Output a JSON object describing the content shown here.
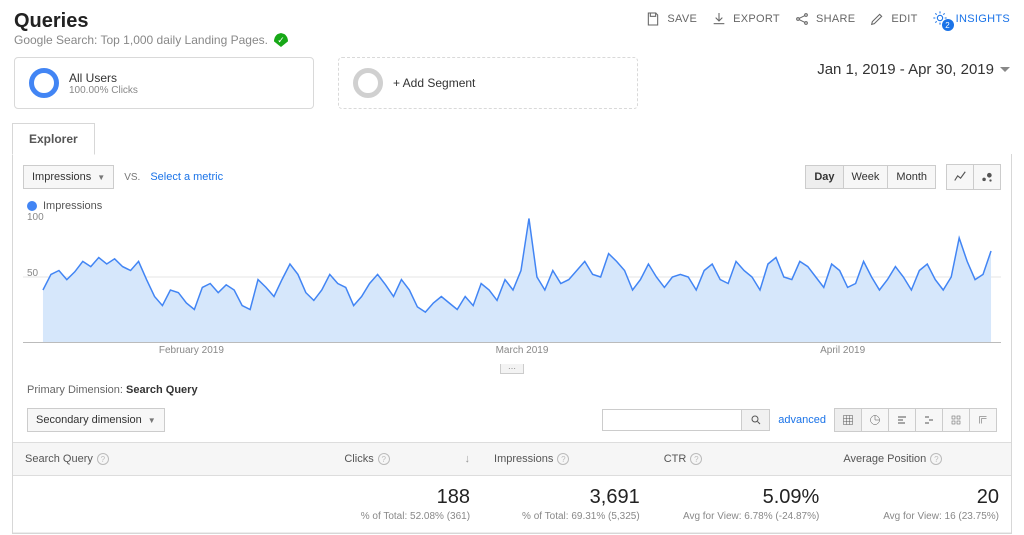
{
  "title": "Queries",
  "subtitle": "Google Search: Top 1,000 daily Landing Pages.",
  "actions": {
    "save": "SAVE",
    "export": "EXPORT",
    "share": "SHARE",
    "edit": "EDIT",
    "insights": "INSIGHTS",
    "insights_count": "2"
  },
  "segments": {
    "all_users": {
      "name": "All Users",
      "detail": "100.00% Clicks"
    },
    "add": {
      "label": "+ Add Segment"
    }
  },
  "date_range": "Jan 1, 2019 - Apr 30, 2019",
  "explorer": {
    "tab": "Explorer",
    "metric": "Impressions",
    "vs": "VS.",
    "select_metric": "Select a metric",
    "legend": "Impressions",
    "granularity": {
      "day": "Day",
      "week": "Week",
      "month": "Month"
    },
    "y_labels": {
      "top": "100",
      "mid": "50"
    },
    "x_labels": [
      "February 2019",
      "March 2019",
      "April 2019"
    ]
  },
  "primary_dimension": {
    "label": "Primary Dimension:",
    "value": "Search Query"
  },
  "secondary_dimension": "Secondary dimension",
  "search": {
    "placeholder": "",
    "advanced": "advanced"
  },
  "table": {
    "headers": {
      "query": "Search Query",
      "clicks": "Clicks",
      "impressions": "Impressions",
      "ctr": "CTR",
      "avg_pos": "Average Position"
    },
    "totals": {
      "clicks": {
        "value": "188",
        "sub": "% of Total: 52.08% (361)"
      },
      "impressions": {
        "value": "3,691",
        "sub": "% of Total: 69.31% (5,325)"
      },
      "ctr": {
        "value": "5.09%",
        "sub": "Avg for View: 6.78% (-24.87%)"
      },
      "avg_pos": {
        "value": "20",
        "sub": "Avg for View: 16 (23.75%)"
      }
    }
  },
  "chart_data": {
    "type": "line",
    "title": "Impressions",
    "ylabel": "Impressions",
    "ylim": [
      0,
      100
    ],
    "x": [
      "Jan 1",
      "Jan 2",
      "Jan 3",
      "Jan 4",
      "Jan 5",
      "Jan 6",
      "Jan 7",
      "Jan 8",
      "Jan 9",
      "Jan 10",
      "Jan 11",
      "Jan 12",
      "Jan 13",
      "Jan 14",
      "Jan 15",
      "Jan 16",
      "Jan 17",
      "Jan 18",
      "Jan 19",
      "Jan 20",
      "Jan 21",
      "Jan 22",
      "Jan 23",
      "Jan 24",
      "Jan 25",
      "Jan 26",
      "Jan 27",
      "Jan 28",
      "Jan 29",
      "Jan 30",
      "Jan 31",
      "Feb 1",
      "Feb 2",
      "Feb 3",
      "Feb 4",
      "Feb 5",
      "Feb 6",
      "Feb 7",
      "Feb 8",
      "Feb 9",
      "Feb 10",
      "Feb 11",
      "Feb 12",
      "Feb 13",
      "Feb 14",
      "Feb 15",
      "Feb 16",
      "Feb 17",
      "Feb 18",
      "Feb 19",
      "Feb 20",
      "Feb 21",
      "Feb 22",
      "Feb 23",
      "Feb 24",
      "Feb 25",
      "Feb 26",
      "Feb 27",
      "Feb 28",
      "Mar 1",
      "Mar 2",
      "Mar 3",
      "Mar 4",
      "Mar 5",
      "Mar 6",
      "Mar 7",
      "Mar 8",
      "Mar 9",
      "Mar 10",
      "Mar 11",
      "Mar 12",
      "Mar 13",
      "Mar 14",
      "Mar 15",
      "Mar 16",
      "Mar 17",
      "Mar 18",
      "Mar 19",
      "Mar 20",
      "Mar 21",
      "Mar 22",
      "Mar 23",
      "Mar 24",
      "Mar 25",
      "Mar 26",
      "Mar 27",
      "Mar 28",
      "Mar 29",
      "Mar 30",
      "Mar 31",
      "Apr 1",
      "Apr 2",
      "Apr 3",
      "Apr 4",
      "Apr 5",
      "Apr 6",
      "Apr 7",
      "Apr 8",
      "Apr 9",
      "Apr 10",
      "Apr 11",
      "Apr 12",
      "Apr 13",
      "Apr 14",
      "Apr 15",
      "Apr 16",
      "Apr 17",
      "Apr 18",
      "Apr 19",
      "Apr 20",
      "Apr 21",
      "Apr 22",
      "Apr 23",
      "Apr 24",
      "Apr 25",
      "Apr 26",
      "Apr 27",
      "Apr 28",
      "Apr 29",
      "Apr 30"
    ],
    "values": [
      40,
      52,
      55,
      48,
      54,
      62,
      58,
      65,
      60,
      64,
      58,
      55,
      62,
      48,
      35,
      28,
      40,
      38,
      30,
      25,
      42,
      45,
      38,
      44,
      40,
      28,
      25,
      48,
      42,
      35,
      48,
      60,
      52,
      38,
      32,
      40,
      52,
      45,
      42,
      28,
      35,
      45,
      52,
      44,
      35,
      48,
      40,
      27,
      23,
      30,
      35,
      30,
      25,
      35,
      28,
      45,
      40,
      32,
      48,
      40,
      55,
      95,
      50,
      40,
      55,
      45,
      48,
      55,
      62,
      52,
      50,
      68,
      62,
      55,
      40,
      48,
      60,
      50,
      42,
      50,
      52,
      50,
      40,
      55,
      60,
      48,
      45,
      62,
      55,
      50,
      40,
      60,
      65,
      50,
      48,
      62,
      58,
      50,
      42,
      60,
      55,
      42,
      45,
      62,
      50,
      40,
      48,
      58,
      50,
      40,
      55,
      60,
      48,
      40,
      50,
      80,
      62,
      48,
      52,
      70
    ]
  }
}
